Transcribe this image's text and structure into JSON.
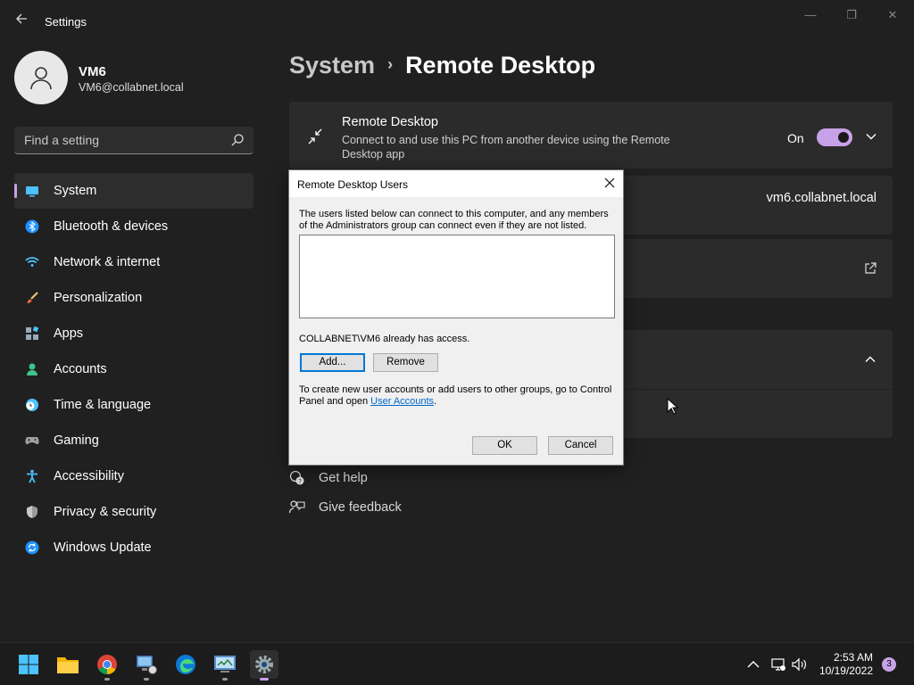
{
  "window": {
    "title": "Settings",
    "back_icon": "back-arrow-icon",
    "minimize": "—",
    "maximize": "❐",
    "close": "✕"
  },
  "profile": {
    "name": "VM6",
    "email": "VM6@collabnet.local"
  },
  "search": {
    "placeholder": "Find a setting"
  },
  "nav": {
    "items": [
      {
        "label": "System",
        "icon": "system-icon",
        "active": true
      },
      {
        "label": "Bluetooth & devices",
        "icon": "bluetooth-icon"
      },
      {
        "label": "Network & internet",
        "icon": "wifi-icon"
      },
      {
        "label": "Personalization",
        "icon": "brush-icon"
      },
      {
        "label": "Apps",
        "icon": "apps-icon"
      },
      {
        "label": "Accounts",
        "icon": "person-icon"
      },
      {
        "label": "Time & language",
        "icon": "clock-globe-icon"
      },
      {
        "label": "Gaming",
        "icon": "gamepad-icon"
      },
      {
        "label": "Accessibility",
        "icon": "accessibility-icon"
      },
      {
        "label": "Privacy & security",
        "icon": "shield-icon"
      },
      {
        "label": "Windows Update",
        "icon": "update-icon"
      }
    ]
  },
  "main": {
    "breadcrumb_parent": "System",
    "breadcrumb_sep": "›",
    "breadcrumb_current": "Remote Desktop",
    "remote_desktop": {
      "title": "Remote Desktop",
      "description": "Connect to and use this PC from another device using the Remote Desktop app",
      "toggle_label": "On",
      "toggle_on": true
    },
    "pc_name": "vm6.collabnet.local",
    "links": [
      {
        "label": "Get help",
        "icon": "help-icon"
      },
      {
        "label": "Give feedback",
        "icon": "feedback-icon"
      }
    ]
  },
  "dialog": {
    "title": "Remote Desktop Users",
    "intro": "The users listed below can connect to this computer, and any members of the Administrators group can connect even if they are not listed.",
    "access_note": "COLLABNET\\VM6 already has access.",
    "add_label": "Add...",
    "remove_label": "Remove",
    "footer_text": "To create new user accounts or add users to other groups, go to Control Panel and open ",
    "footer_link": "User Accounts",
    "footer_end": ".",
    "ok_label": "OK",
    "cancel_label": "Cancel"
  },
  "taskbar": {
    "apps": [
      "start-icon",
      "file-explorer-icon",
      "chrome-icon",
      "remote-desktop-connection-icon",
      "edge-icon",
      "control-panel-icon",
      "settings-icon"
    ],
    "time": "2:53 AM",
    "date": "10/19/2022",
    "notification_count": "3"
  },
  "colors": {
    "accent": "#c8a2e8",
    "background": "#202020",
    "card": "#2b2b2b"
  }
}
